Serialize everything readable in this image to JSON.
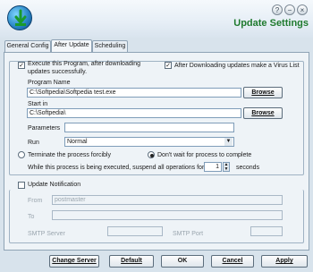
{
  "window": {
    "title": "Update Settings",
    "help_glyph": "?",
    "minimize_glyph": "−",
    "close_glyph": "×"
  },
  "tabs": [
    {
      "label": "General Config"
    },
    {
      "label": "After Update",
      "active": true
    },
    {
      "label": "Scheduling"
    }
  ],
  "execute": {
    "checkbox_label": "Execute this Program, after downloading updates successfully.",
    "checked": true,
    "virus_label": "After Downloading updates make a Virus List",
    "virus_checked": true,
    "program_name_label": "Program Name",
    "program_name_value": "C:\\Softpedia\\Softpedia test.exe",
    "start_in_label": "Start in",
    "start_in_value": "C:\\Softpedia\\",
    "browse_label": "Browse",
    "parameters_label": "Parameters",
    "parameters_value": "",
    "run_label": "Run",
    "run_value": "Normal",
    "terminate_label": "Terminate the process forcibly",
    "dont_wait_label": "Don't wait for process to complete",
    "selected_option": "dont_wait",
    "suspend_prefix": "While this process is being executed, suspend all operations for",
    "suspend_value": "1",
    "suspend_suffix": "seconds"
  },
  "notification": {
    "checkbox_label": "Update Notification",
    "checked": false,
    "from_label": "From",
    "from_value": "postmaster",
    "to_label": "To",
    "to_value": "",
    "smtp_server_label": "SMTP Server",
    "smtp_server_value": "",
    "smtp_port_label": "SMTP Port",
    "smtp_port_value": ""
  },
  "buttons": {
    "change_server": "Change Server",
    "default": "Default",
    "ok": "OK",
    "cancel": "Cancel",
    "apply": "Apply"
  },
  "colors": {
    "title": "#1f7a2e",
    "background": "#d8e3ec"
  }
}
